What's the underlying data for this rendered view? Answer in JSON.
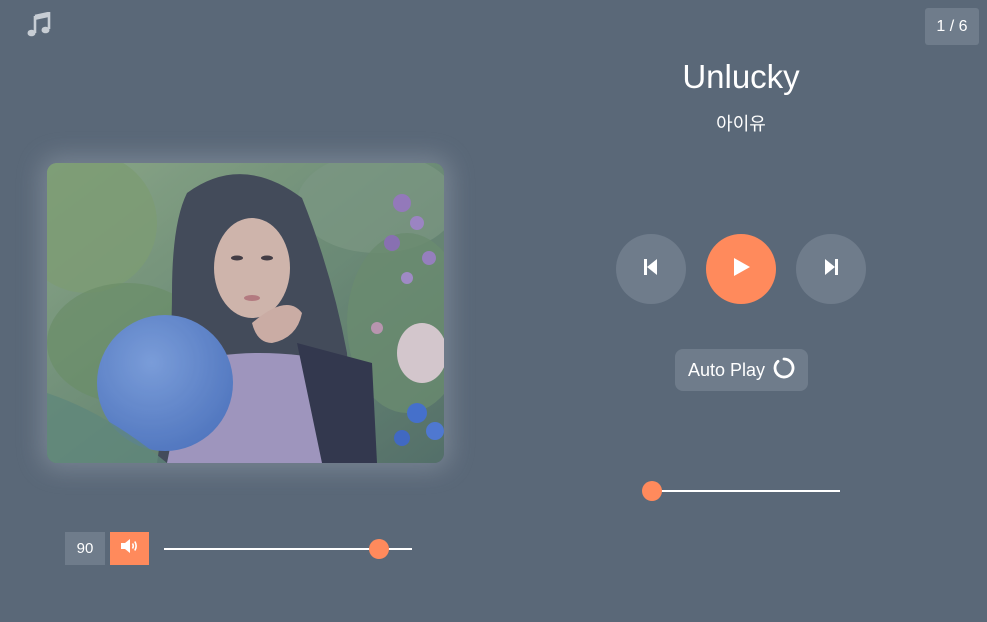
{
  "header": {
    "app_icon": "music-note-icon",
    "track_counter": "1 / 6"
  },
  "album": {
    "art_icon": "album-cover-image"
  },
  "track": {
    "title": "Unlucky",
    "artist": "아이유"
  },
  "controls": {
    "prev_icon": "skip-previous-icon",
    "play_icon": "play-icon",
    "next_icon": "skip-next-icon",
    "autoplay_label": "Auto Play",
    "autoplay_icon": "circle-loop-icon"
  },
  "progress": {
    "position": 0.0
  },
  "volume": {
    "value": "90",
    "level": 0.9,
    "icon": "speaker-volume-icon"
  },
  "colors": {
    "background": "#5a6878",
    "accent": "#ff8a5c",
    "button_bg": "#6f7c8b"
  }
}
